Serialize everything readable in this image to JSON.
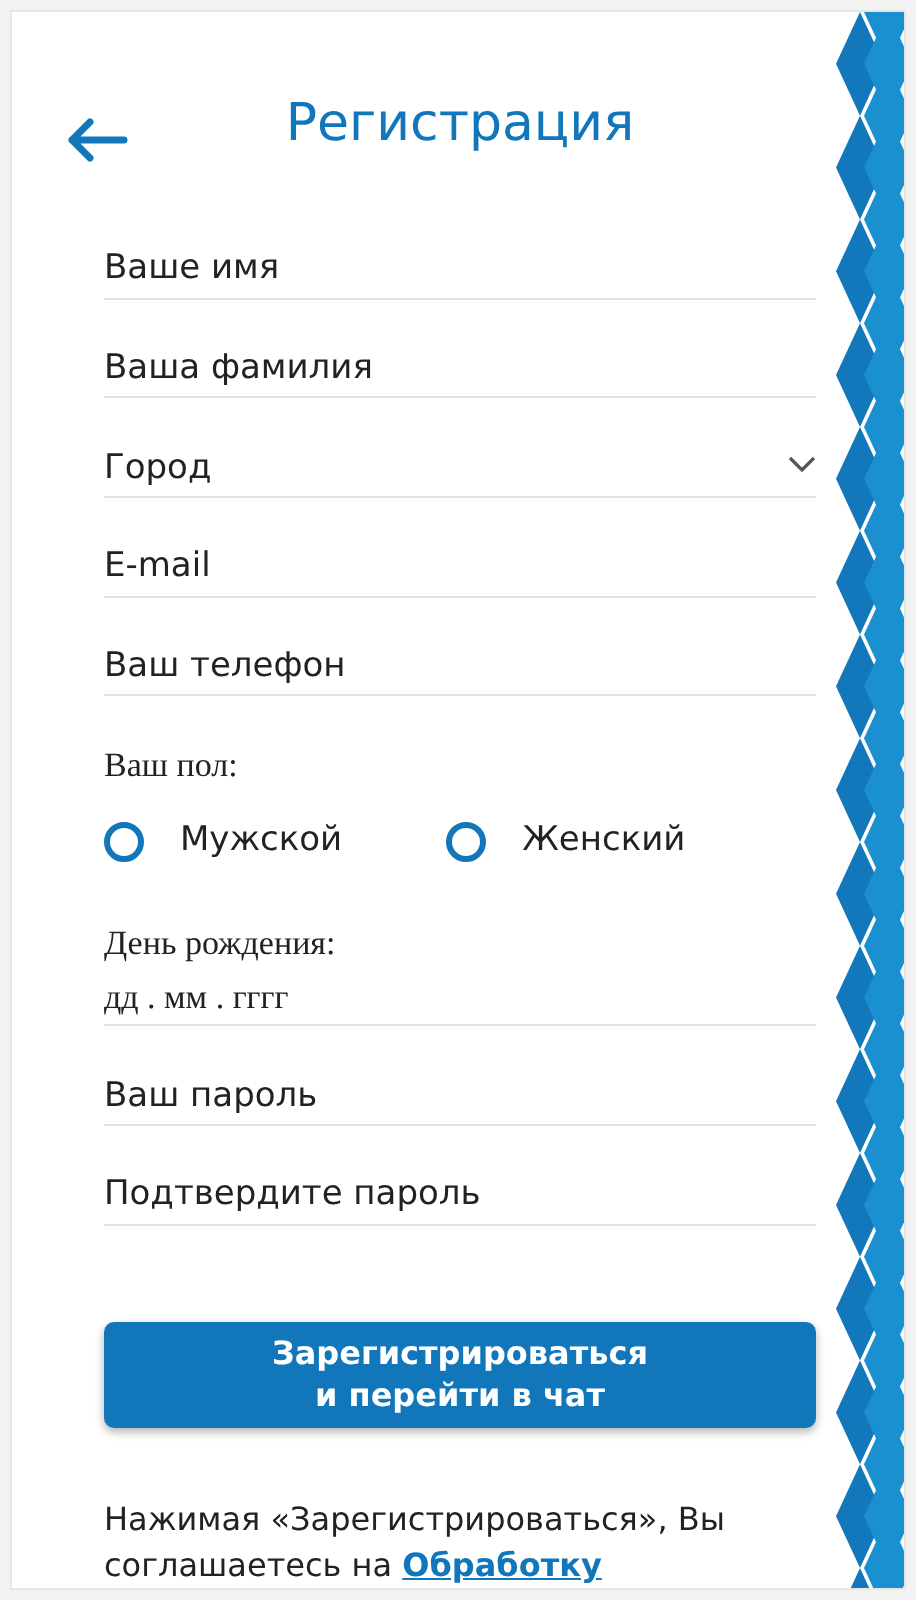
{
  "header": {
    "title": "Регистрация"
  },
  "fields_top": [
    {
      "kind": "text",
      "placeholder": "Ваше имя"
    },
    {
      "kind": "text",
      "placeholder": "Ваша фамилия"
    },
    {
      "kind": "select",
      "placeholder": "Город"
    },
    {
      "kind": "text",
      "placeholder": "E-mail"
    },
    {
      "kind": "text",
      "placeholder": "Ваш телефон"
    }
  ],
  "gender": {
    "label": "Ваш пол:",
    "options": [
      {
        "label": "Мужской",
        "selected": false
      },
      {
        "label": "Женский",
        "selected": false
      }
    ]
  },
  "birthday": {
    "label": "День рождения:",
    "placeholder": "дд . мм . гггг"
  },
  "fields_bottom": [
    {
      "placeholder": "Ваш пароль"
    },
    {
      "placeholder": "Подтвердите пароль"
    }
  ],
  "submit": {
    "lines": [
      "Зарегистрироваться",
      "и перейти в чат"
    ]
  },
  "notice": {
    "text": "Нажимая «Зарегистрироваться», Вы соглашаетесь на",
    "link": "Обработку"
  }
}
